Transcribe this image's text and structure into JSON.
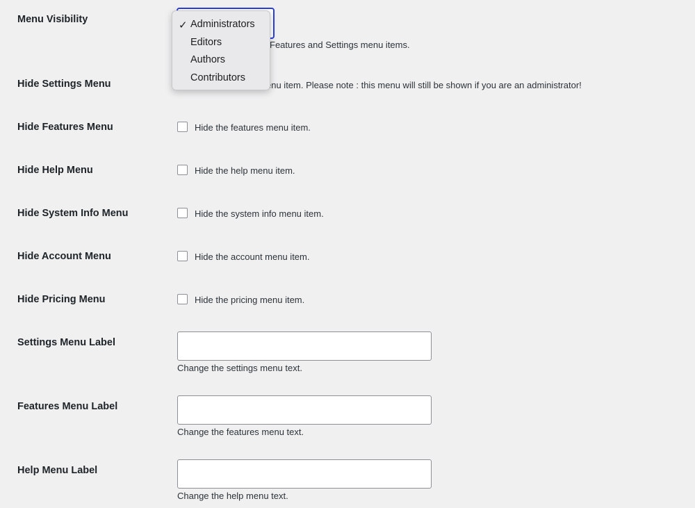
{
  "menu_visibility": {
    "label": "Menu Visibility",
    "description_visible": "Features and Settings menu items.",
    "options": [
      "Administrators",
      "Editors",
      "Authors",
      "Contributors"
    ],
    "selected": "Administrators",
    "checkmark": "✓"
  },
  "hide_settings": {
    "label": "Hide Settings Menu",
    "description_visible": "enu item. Please note : this menu will still be shown if you are an administrator!"
  },
  "hide_features": {
    "label": "Hide Features Menu",
    "description": "Hide the features menu item."
  },
  "hide_help": {
    "label": "Hide Help Menu",
    "description": "Hide the help menu item."
  },
  "hide_system_info": {
    "label": "Hide System Info Menu",
    "description": "Hide the system info menu item."
  },
  "hide_account": {
    "label": "Hide Account Menu",
    "description": "Hide the account menu item."
  },
  "hide_pricing": {
    "label": "Hide Pricing Menu",
    "description": "Hide the pricing menu item."
  },
  "settings_label": {
    "label": "Settings Menu Label",
    "value": "",
    "description": "Change the settings menu text."
  },
  "features_label": {
    "label": "Features Menu Label",
    "value": "",
    "description": "Change the features menu text."
  },
  "help_label": {
    "label": "Help Menu Label",
    "value": "",
    "description": "Change the help menu text."
  },
  "colors": {
    "background": "#f0f0f1",
    "focus_border": "#2b3fd6",
    "dropdown_bg": "#e9e9eb"
  }
}
